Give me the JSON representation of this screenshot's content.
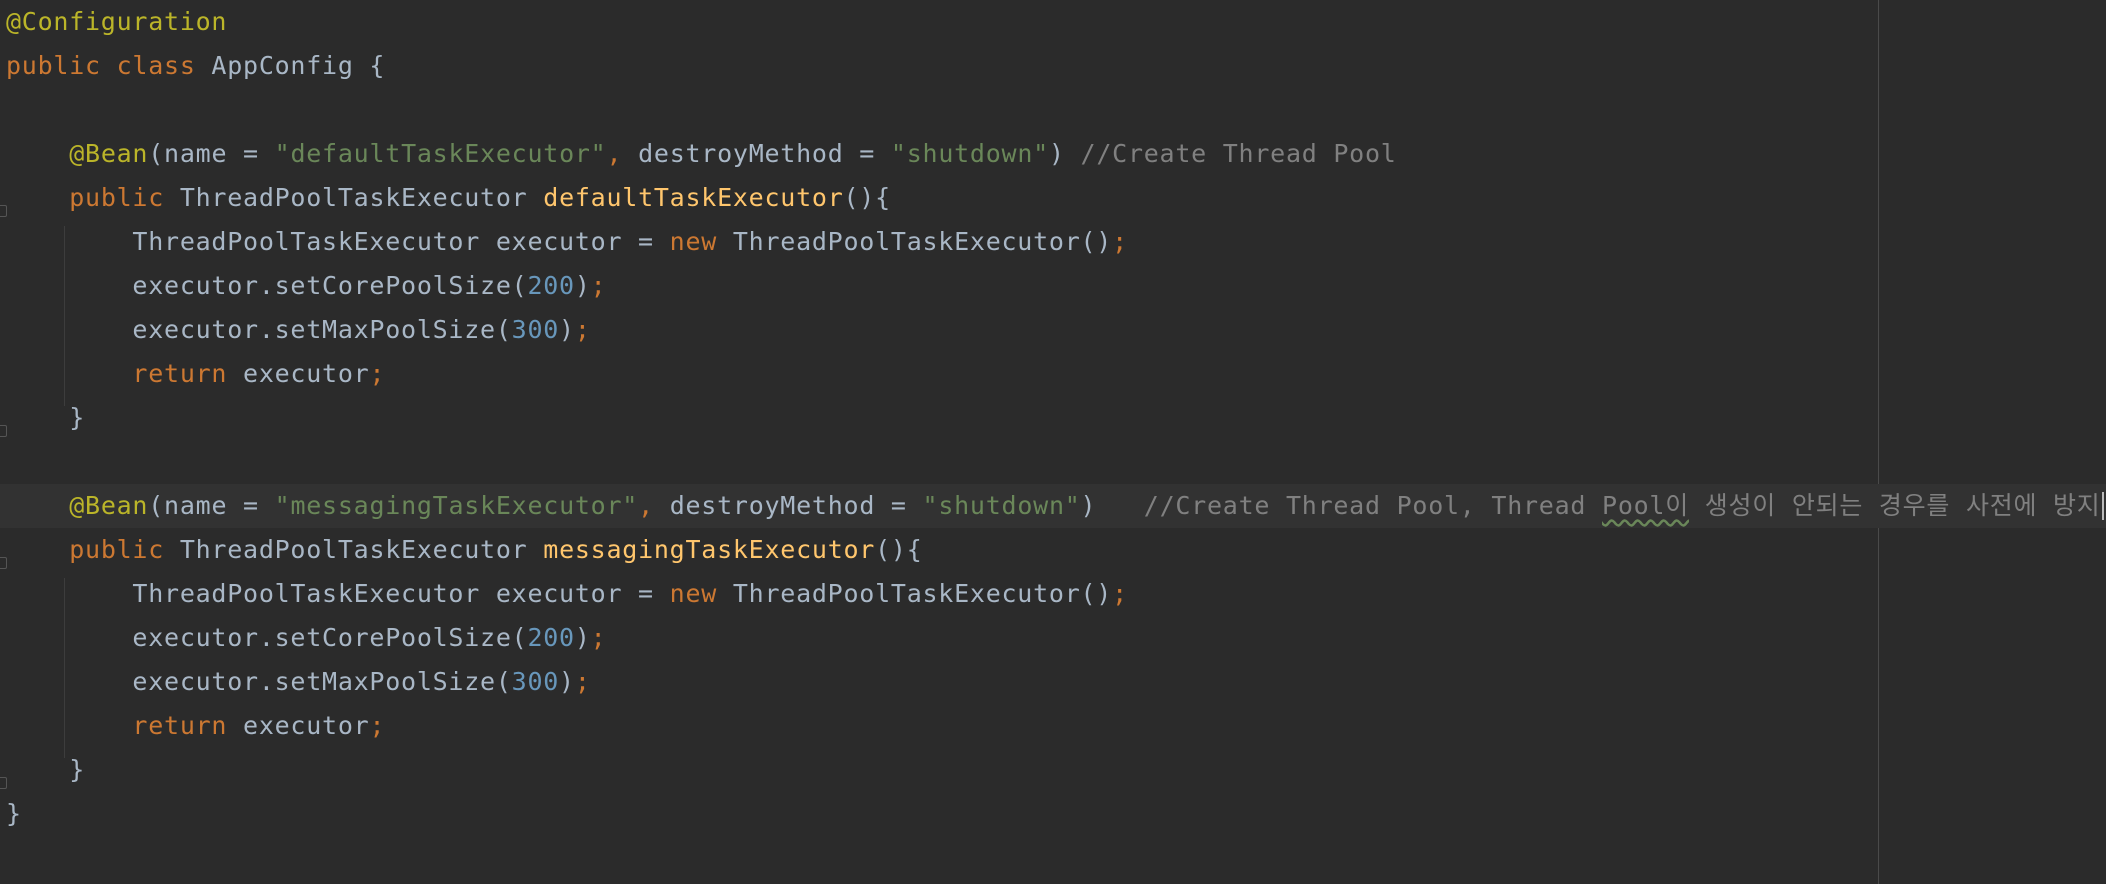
{
  "editor": {
    "lines": [
      [
        {
          "t": "@Configuration",
          "c": "annotation"
        }
      ],
      [
        {
          "t": "public ",
          "c": "keyword"
        },
        {
          "t": "class ",
          "c": "keyword"
        },
        {
          "t": "AppConfig {",
          "c": "plain"
        }
      ],
      [],
      [
        {
          "t": "    ",
          "c": "plain"
        },
        {
          "t": "@Bean",
          "c": "annotation"
        },
        {
          "t": "(name = ",
          "c": "plain"
        },
        {
          "t": "\"defaultTaskExecutor\"",
          "c": "string"
        },
        {
          "t": ", ",
          "c": "semi"
        },
        {
          "t": "destroyMethod = ",
          "c": "plain"
        },
        {
          "t": "\"shutdown\"",
          "c": "string"
        },
        {
          "t": ") ",
          "c": "plain"
        },
        {
          "t": "//Create Thread Pool",
          "c": "comment"
        }
      ],
      [
        {
          "t": "    ",
          "c": "plain"
        },
        {
          "t": "public ",
          "c": "keyword"
        },
        {
          "t": "ThreadPoolTaskExecutor ",
          "c": "plain"
        },
        {
          "t": "defaultTaskExecutor",
          "c": "method"
        },
        {
          "t": "(){",
          "c": "plain"
        }
      ],
      [
        {
          "t": "        ThreadPoolTaskExecutor executor = ",
          "c": "plain"
        },
        {
          "t": "new ",
          "c": "keyword"
        },
        {
          "t": "ThreadPoolTaskExecutor()",
          "c": "plain"
        },
        {
          "t": ";",
          "c": "semi"
        }
      ],
      [
        {
          "t": "        executor.setCorePoolSize(",
          "c": "plain"
        },
        {
          "t": "200",
          "c": "number"
        },
        {
          "t": ")",
          "c": "plain"
        },
        {
          "t": ";",
          "c": "semi"
        }
      ],
      [
        {
          "t": "        executor.setMaxPoolSize(",
          "c": "plain"
        },
        {
          "t": "300",
          "c": "number"
        },
        {
          "t": ")",
          "c": "plain"
        },
        {
          "t": ";",
          "c": "semi"
        }
      ],
      [
        {
          "t": "        ",
          "c": "plain"
        },
        {
          "t": "return ",
          "c": "keyword"
        },
        {
          "t": "executor",
          "c": "plain"
        },
        {
          "t": ";",
          "c": "semi"
        }
      ],
      [
        {
          "t": "    }",
          "c": "plain"
        }
      ],
      [],
      [
        {
          "t": "    ",
          "c": "plain"
        },
        {
          "t": "@Bean",
          "c": "annotation"
        },
        {
          "t": "(name = ",
          "c": "plain"
        },
        {
          "t": "\"messagingTaskExecutor\"",
          "c": "string"
        },
        {
          "t": ", ",
          "c": "semi"
        },
        {
          "t": "destroyMethod = ",
          "c": "plain"
        },
        {
          "t": "\"shutdown\"",
          "c": "string"
        },
        {
          "t": ")   ",
          "c": "plain"
        },
        {
          "t": "//Create Thread Pool, Thread ",
          "c": "comment"
        },
        {
          "t": "Pool이",
          "c": "comment",
          "typo": true
        },
        {
          "t": " 생성이 안되는 경우를 사전에 방지",
          "c": "comment"
        }
      ],
      [
        {
          "t": "    ",
          "c": "plain"
        },
        {
          "t": "public ",
          "c": "keyword"
        },
        {
          "t": "ThreadPoolTaskExecutor ",
          "c": "plain"
        },
        {
          "t": "messagingTaskExecutor",
          "c": "method"
        },
        {
          "t": "(){",
          "c": "plain"
        }
      ],
      [
        {
          "t": "        ThreadPoolTaskExecutor executor = ",
          "c": "plain"
        },
        {
          "t": "new ",
          "c": "keyword"
        },
        {
          "t": "ThreadPoolTaskExecutor()",
          "c": "plain"
        },
        {
          "t": ";",
          "c": "semi"
        }
      ],
      [
        {
          "t": "        executor.setCorePoolSize(",
          "c": "plain"
        },
        {
          "t": "200",
          "c": "number"
        },
        {
          "t": ")",
          "c": "plain"
        },
        {
          "t": ";",
          "c": "semi"
        }
      ],
      [
        {
          "t": "        executor.setMaxPoolSize(",
          "c": "plain"
        },
        {
          "t": "300",
          "c": "number"
        },
        {
          "t": ")",
          "c": "plain"
        },
        {
          "t": ";",
          "c": "semi"
        }
      ],
      [
        {
          "t": "        ",
          "c": "plain"
        },
        {
          "t": "return ",
          "c": "keyword"
        },
        {
          "t": "executor",
          "c": "plain"
        },
        {
          "t": ";",
          "c": "semi"
        }
      ],
      [
        {
          "t": "    }",
          "c": "plain"
        }
      ],
      [
        {
          "t": "}",
          "c": "plain"
        }
      ]
    ],
    "current_line": 11,
    "caret_line": 11,
    "colors": {
      "background": "#2b2b2b",
      "annotation": "#bbb529",
      "keyword": "#cc7832",
      "string": "#6a8759",
      "number": "#6897bb",
      "comment": "#808080",
      "method": "#ffc66d",
      "plain": "#a9b7c6"
    }
  }
}
